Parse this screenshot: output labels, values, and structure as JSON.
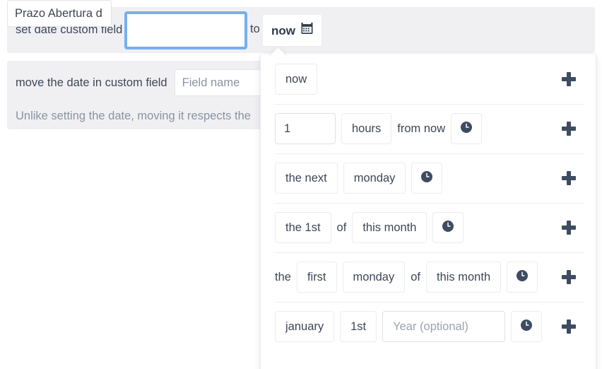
{
  "rules": {
    "set_date": {
      "prefix": "set date custom field",
      "field_value": "Prazo Abertura d",
      "field_placeholder": "Field name",
      "connector": "to",
      "value_button": "now",
      "value_button_icon": "calendar-icon"
    },
    "move_date": {
      "prefix": "move the date in custom field",
      "field_value": "",
      "field_placeholder": "Field name",
      "description": "Unlike setting the date, moving it respects the"
    }
  },
  "dropdown": {
    "add_icon": "plus-icon",
    "clock_icon": "clock-icon",
    "rows": [
      {
        "id": "now",
        "parts": [
          {
            "kind": "chip",
            "text": "now"
          }
        ]
      },
      {
        "id": "relative-offset",
        "parts": [
          {
            "kind": "input",
            "value": "1",
            "variant": "num"
          },
          {
            "kind": "chip",
            "text": "hours"
          },
          {
            "kind": "text",
            "text": "from now"
          },
          {
            "kind": "clock"
          }
        ]
      },
      {
        "id": "next-weekday",
        "parts": [
          {
            "kind": "chip",
            "text": "the next"
          },
          {
            "kind": "chip",
            "text": "monday"
          },
          {
            "kind": "clock"
          }
        ]
      },
      {
        "id": "nth-of-month",
        "parts": [
          {
            "kind": "chip",
            "text": "the 1st"
          },
          {
            "kind": "text",
            "text": "of"
          },
          {
            "kind": "chip",
            "text": "this month"
          },
          {
            "kind": "clock"
          }
        ]
      },
      {
        "id": "ordinal-weekday-of-month",
        "parts": [
          {
            "kind": "text",
            "text": "the"
          },
          {
            "kind": "chip",
            "text": "first"
          },
          {
            "kind": "chip",
            "text": "monday"
          },
          {
            "kind": "text",
            "text": "of"
          },
          {
            "kind": "chip",
            "text": "this month"
          },
          {
            "kind": "clock"
          }
        ]
      },
      {
        "id": "specific-date",
        "parts": [
          {
            "kind": "chip",
            "text": "january"
          },
          {
            "kind": "chip",
            "text": "1st"
          },
          {
            "kind": "input",
            "value": "",
            "placeholder": "Year (optional)",
            "variant": "year"
          },
          {
            "kind": "clock"
          }
        ]
      }
    ]
  },
  "colors": {
    "focus_ring": "#76afef",
    "block_background": "#f0f0f3",
    "text_primary": "#3d4757",
    "text_muted": "#8a93a3",
    "icon_dark": "#3e4c61"
  }
}
